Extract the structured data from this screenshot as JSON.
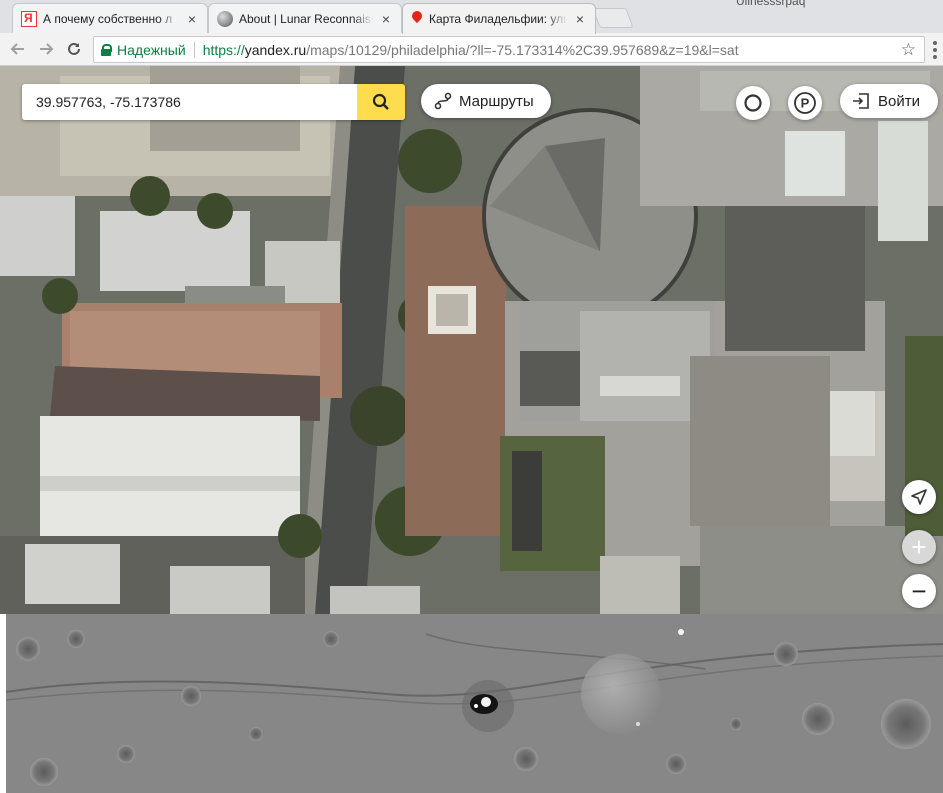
{
  "browser": {
    "user_label": "Ulinesssrpaq",
    "tabs": [
      {
        "title": "А почему собственно л",
        "favicon": "yandex-icon",
        "active": false
      },
      {
        "title": "About | Lunar Reconnaiss",
        "favicon": "moon-icon",
        "active": false
      },
      {
        "title": "Карта Филадельфии: ули",
        "favicon": "map-pin-icon",
        "active": true
      }
    ],
    "close_glyph": "×",
    "address": {
      "secure_label": "Надежный",
      "scheme": "https://",
      "host": "yandex.ru",
      "path": "/maps/10129/philadelphia/?ll=-75.173314%2C39.957689&z=19&l=sat"
    }
  },
  "map": {
    "search": {
      "value": "39.957763, -75.173786"
    },
    "routes_label": "Маршруты",
    "parking_glyph": "P",
    "login_label": "Войти",
    "zoom_in_glyph": "+",
    "zoom_out_glyph": "−"
  },
  "colors": {
    "accent": "#ffdb4d",
    "secure": "#0b8043"
  }
}
